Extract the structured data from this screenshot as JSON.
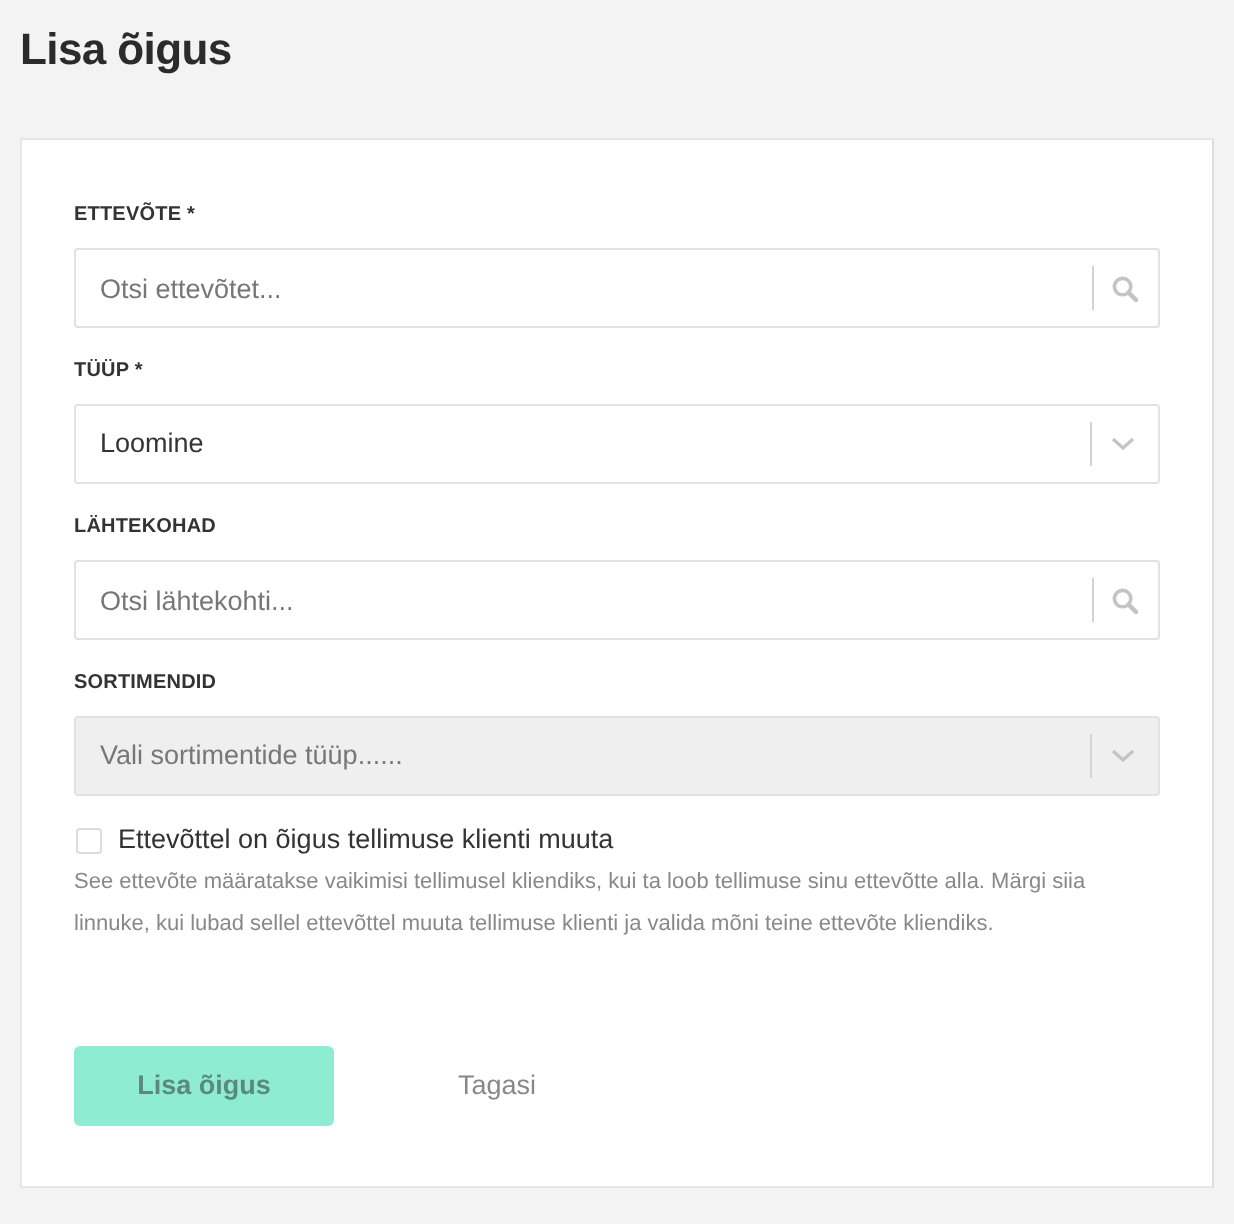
{
  "page": {
    "title": "Lisa õigus"
  },
  "fields": [
    {
      "kind": "search",
      "label": "ETTEVÕTE *",
      "placeholder": "Otsi ettevõtet...",
      "disabled": false
    },
    {
      "kind": "select",
      "label": "TÜÜP *",
      "value": "Loomine",
      "disabled": false
    },
    {
      "kind": "search",
      "label": "LÄHTEKOHAD",
      "placeholder": "Otsi lähtekohti...",
      "disabled": false
    },
    {
      "kind": "select",
      "label": "SORTIMENDID",
      "placeholder": "Vali sortimentide tüüp......",
      "disabled": true
    }
  ],
  "checkbox": {
    "label": "Ettevõttel on õigus tellimuse klienti muuta",
    "checked": false,
    "help": "See ettevõte määratakse vaikimisi tellimusel kliendiks, kui ta loob tellimuse sinu ettevõtte alla. Märgi siia linnuke, kui lubad sellel ettevõttel muuta tellimuse klienti ja valida mõni teine ettevõte kliendiks."
  },
  "buttons": [
    {
      "kind": "primary",
      "label": "Lisa õigus",
      "disabled": true
    },
    {
      "kind": "link",
      "label": "Tagasi",
      "disabled": false
    }
  ]
}
